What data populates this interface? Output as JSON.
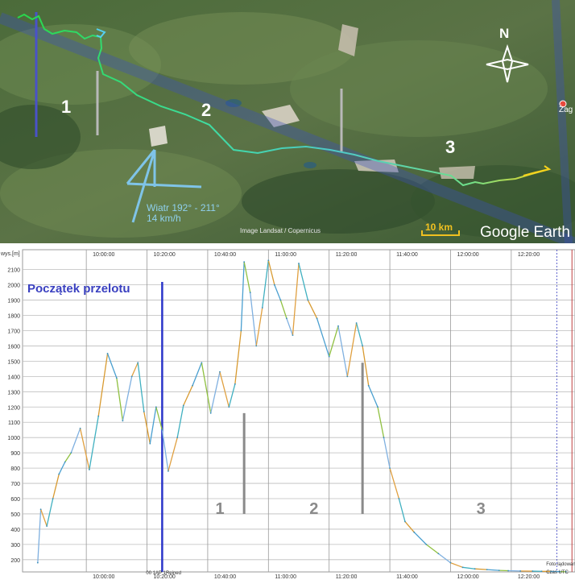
{
  "map": {
    "north_label": "N",
    "segment_labels": [
      "1",
      "2",
      "3"
    ],
    "wind_text": [
      "Wiatr 192° - 211°",
      "14 km/h"
    ],
    "attribution": "Image Landsat / Copernicus",
    "scale_label": "10 km",
    "brand": "Google Earth",
    "place_label": "Żag",
    "colors": {
      "track_start": "#28d84a",
      "track_mid": "#4ec8c8",
      "track_end": "#f5d21c",
      "task_line": "#4a52c8",
      "wind": "#7fc4e8",
      "scale": "#f0c020"
    }
  },
  "chart_data": {
    "type": "line",
    "title": "",
    "ylabel": "wys.[m]",
    "yticks": [
      200,
      300,
      400,
      500,
      600,
      700,
      800,
      900,
      1000,
      1100,
      1200,
      1300,
      1400,
      1500,
      1600,
      1700,
      1800,
      1900,
      2000,
      2100
    ],
    "ylim": [
      120,
      2230
    ],
    "xticks": [
      "10:00:00",
      "10:20:00",
      "10:40:00",
      "11:00:00",
      "11:20:00",
      "11:40:00",
      "12:00:00",
      "12:20:00"
    ],
    "xlim_minutes": [
      -21,
      161
    ],
    "annotation": "Początek przelotu",
    "bottom_labels": [
      "00 1AP 1Reined",
      "Foto-lądowanie",
      "Czas UTC"
    ],
    "segment_labels": [
      "1",
      "2",
      "3"
    ],
    "start_line_minute": 25,
    "finish_line_minute": 160,
    "separators": [
      {
        "minute": 52,
        "from": 500,
        "to": 1160
      },
      {
        "minute": 91,
        "from": 500,
        "to": 1490
      }
    ],
    "series": [
      {
        "x": [
          -16,
          -15,
          -13,
          -11,
          -9,
          -7,
          -5,
          -2,
          1,
          4,
          7,
          10,
          12,
          15,
          17,
          19,
          21,
          23,
          25,
          27,
          30,
          32,
          35,
          38,
          41,
          44,
          47,
          49,
          51,
          52,
          54,
          56,
          58,
          60,
          62,
          64,
          66,
          68,
          70,
          73,
          76,
          80,
          83,
          86,
          89,
          91,
          93,
          96,
          98,
          100,
          103,
          105,
          108,
          112,
          116,
          120,
          124,
          128,
          132,
          136,
          139,
          143,
          147,
          150,
          153,
          156,
          158
        ],
        "y": [
          180,
          530,
          420,
          600,
          760,
          840,
          900,
          1060,
          790,
          1140,
          1550,
          1390,
          1110,
          1400,
          1490,
          1170,
          960,
          1200,
          1050,
          780,
          1000,
          1210,
          1340,
          1490,
          1160,
          1430,
          1200,
          1350,
          1700,
          2150,
          1950,
          1600,
          1850,
          2160,
          2000,
          1900,
          1780,
          1670,
          2140,
          1900,
          1780,
          1530,
          1730,
          1400,
          1750,
          1600,
          1340,
          1200,
          1000,
          800,
          600,
          450,
          380,
          300,
          240,
          180,
          150,
          140,
          135,
          130,
          128,
          126,
          125,
          124,
          123,
          122,
          121
        ]
      }
    ]
  }
}
